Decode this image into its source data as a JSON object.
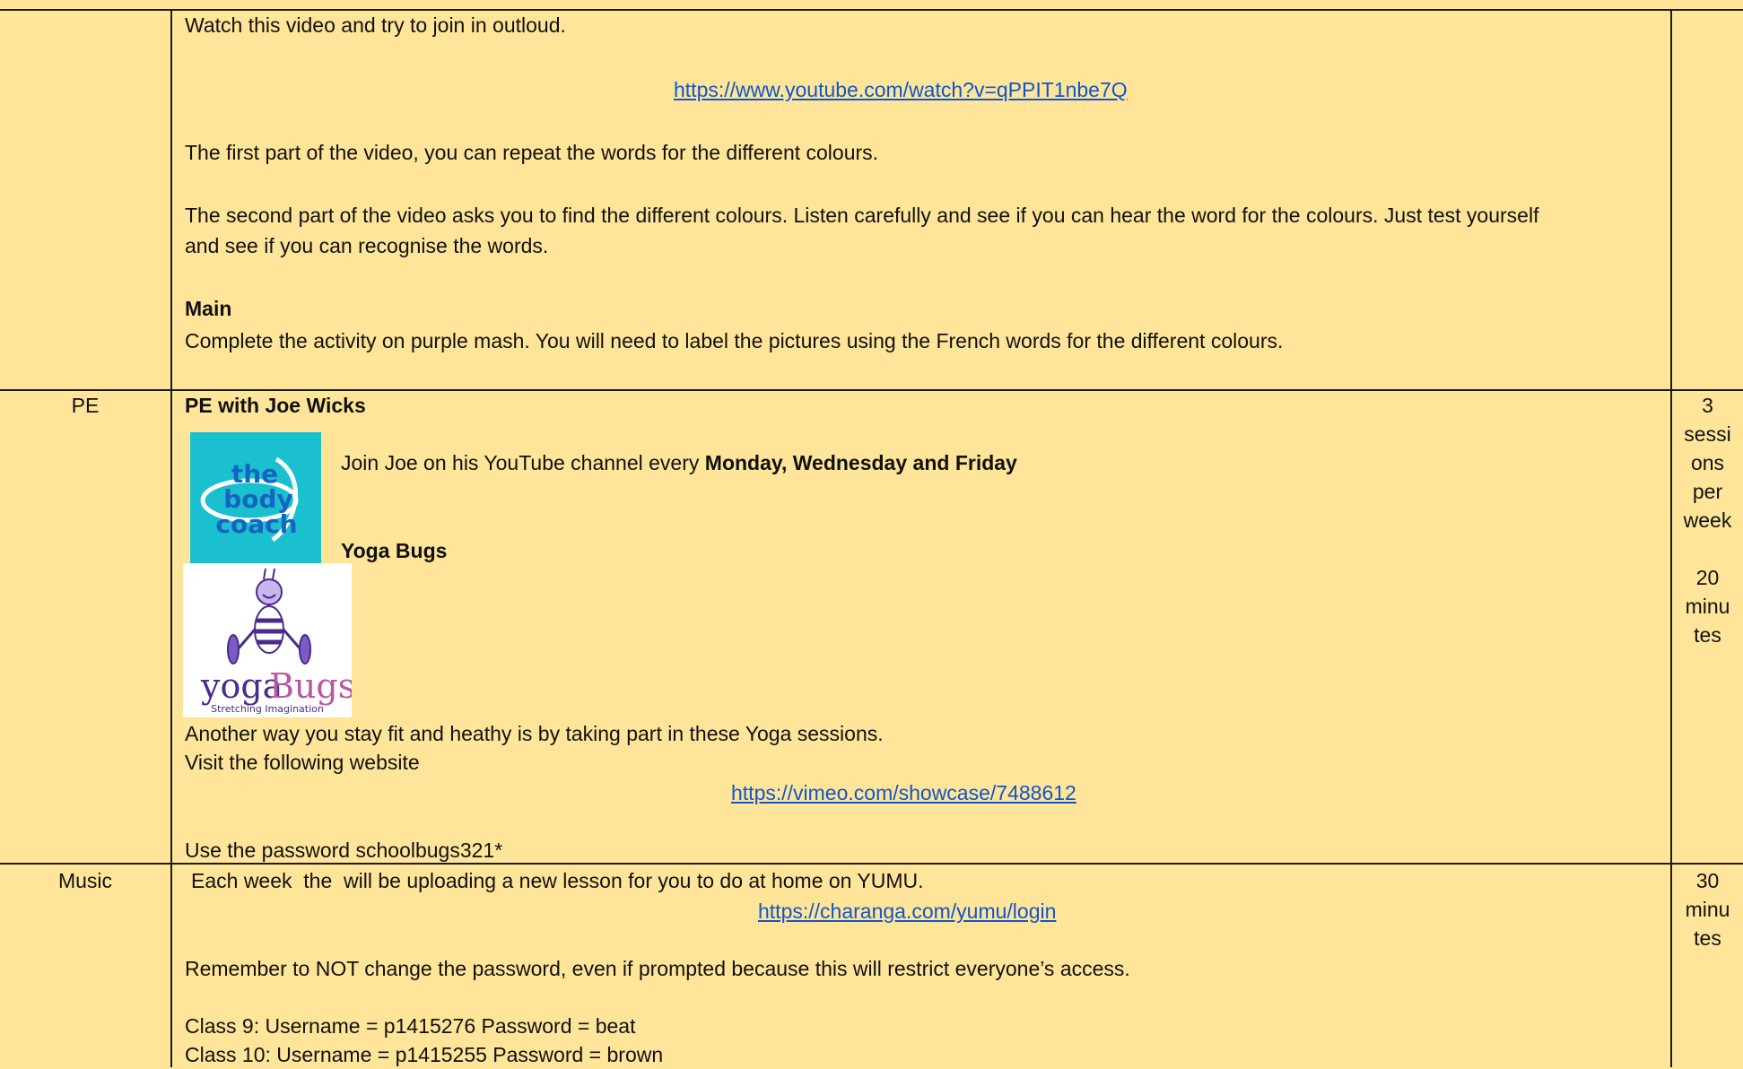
{
  "french": {
    "intro": "Watch this video and try to join in outloud.",
    "video_link": "https://www.youtube.com/watch?v=qPPIT1nbe7Q",
    "first_part": "The first part of the video, you can repeat the words for the different colours.",
    "second_part_line1": "The second part of the video asks you to find the different colours. Listen carefully and see if you can hear the word for the colours. Just test yourself",
    "second_part_line2": "and see if you can recognise the words.",
    "main_heading": "Main",
    "main_text": "Complete the activity on purple mash. You will need to label the pictures using the French words for the different colours."
  },
  "pe": {
    "subject": "PE",
    "heading": "PE with Joe Wicks",
    "join_prefix": "Join Joe on his YouTube channel every ",
    "join_days": "Monday, Wednesday and Friday",
    "yoga_heading": "Yoga Bugs",
    "yoga_text": "Another way you stay fit and heathy is by taking part in these Yoga sessions.",
    "visit_text": "Visit the following website",
    "vimeo_link": "https://vimeo.com/showcase/7488612",
    "password_text": "Use the password schoolbugs321*",
    "duration_lines": [
      "3",
      "sessi",
      "ons",
      "per",
      "week",
      "",
      "20",
      "minu",
      "tes"
    ],
    "coach_logo_text": [
      "the",
      "body",
      "coach"
    ],
    "yogabugs_logo": {
      "yoga": "yoga",
      "bugs": "Bugs",
      "tagline": "Stretching Imagination"
    }
  },
  "music": {
    "subject": "Music",
    "intro": "Each week  the  will be uploading a new lesson for you to do at home on YUMU.",
    "link": "https://charanga.com/yumu/login",
    "warning": "Remember to NOT change the password, even if prompted because this will restrict everyone’s access.",
    "class9": "Class 9: Username = p1415276 Password = beat",
    "class10": "Class 10: Username = p1415255 Password = brown",
    "duration_lines": [
      "30",
      "minu",
      "tes"
    ]
  },
  "colors": {
    "background": "#ffe599",
    "link": "#1155cc",
    "border": "#1a1a1a",
    "coach_logo_bg": "#1bc0cf",
    "coach_logo_text": "#1565c0",
    "yogabugs_purple": "#4a2a8a",
    "yogabugs_pink": "#b55aa0"
  }
}
